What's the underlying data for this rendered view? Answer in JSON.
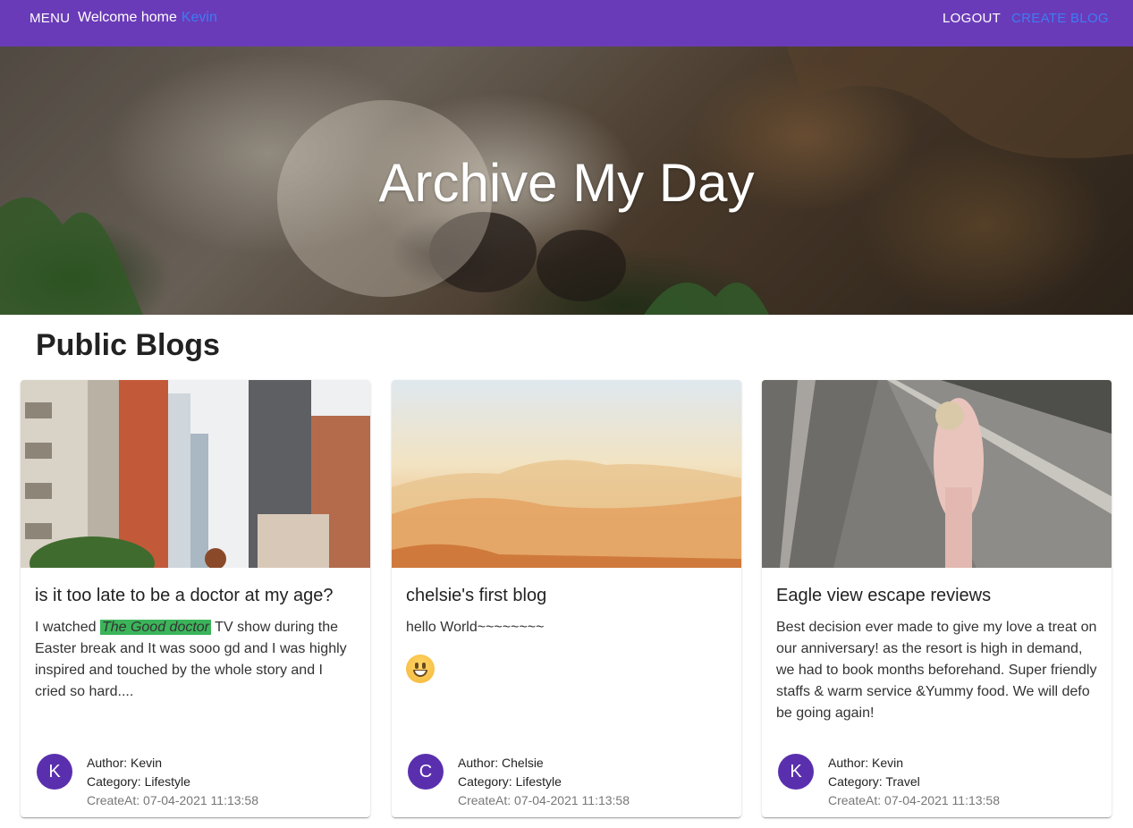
{
  "topbar": {
    "menu_label": "MENU",
    "welcome_text": "Welcome home",
    "user_name": "Kevin",
    "logout_label": "LOGOUT",
    "create_label": "CREATE BLOG"
  },
  "hero": {
    "title": "Archive My Day"
  },
  "section": {
    "title": "Public Blogs"
  },
  "cards": [
    {
      "title": "is it too late to be a doctor at my age?",
      "body_before": "I watched",
      "body_highlight": "The Good doctor",
      "body_after": "TV show during the Easter break and It was sooo gd and I was highly inspired and touched by the whole story and I cried so hard....",
      "avatar_letter": "K",
      "author": "Author: Kevin",
      "category": "Category: Lifestyle",
      "created": "CreateAt: 07-04-2021 11:13:58"
    },
    {
      "title": "chelsie's first blog",
      "body": "hello World~~~~~~~~",
      "emoji": "grinning-face",
      "avatar_letter": "C",
      "author": "Author: Chelsie",
      "category": "Category: Lifestyle",
      "created": "CreateAt: 07-04-2021 11:13:58"
    },
    {
      "title": "Eagle view escape reviews",
      "body": "Best decision ever made to give my love a treat on our anniversary! as the resort is high in demand, we had to book months beforehand. Super friendly staffs & warm service &Yummy food. We will defo be going again!",
      "avatar_letter": "K",
      "author": "Author: Kevin",
      "category": "Category: Travel",
      "created": "CreateAt: 07-04-2021 11:13:58"
    }
  ],
  "colors": {
    "topbar": "#6a3bb8",
    "link": "#3d7cf5",
    "avatar": "#5a2fae",
    "highlight": "#3cb45a"
  }
}
